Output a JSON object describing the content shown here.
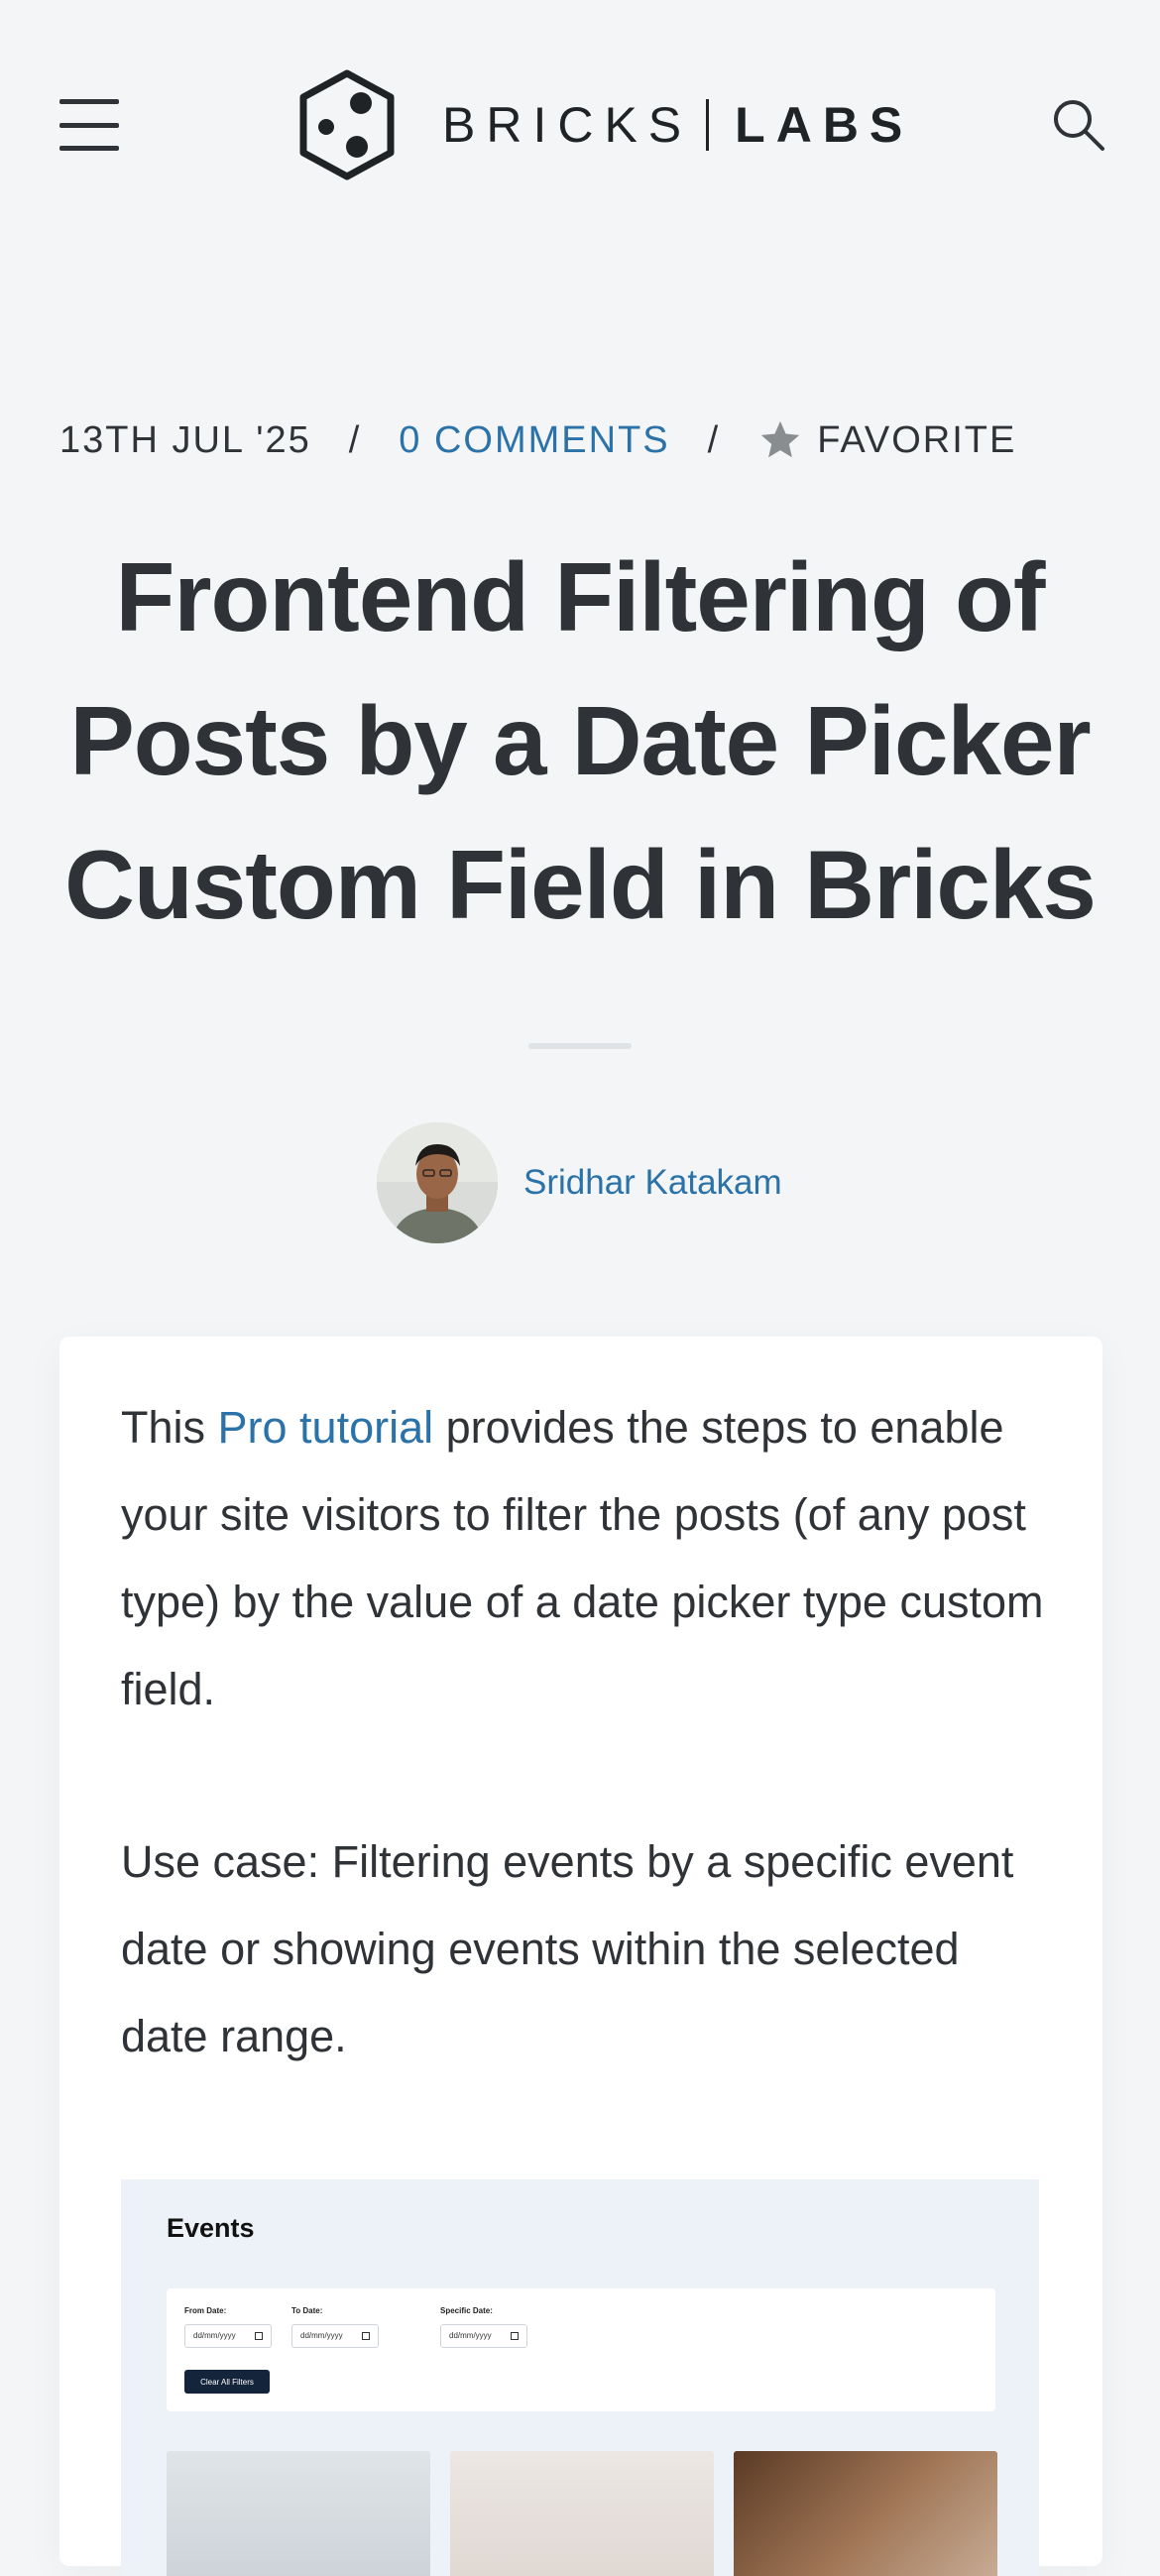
{
  "header": {
    "logo_brand": "BRICKS",
    "logo_product": "LABS",
    "menu_icon": "hamburger-menu-icon",
    "search_icon": "search-icon"
  },
  "meta": {
    "date": "13TH JUL '25",
    "separator": "/",
    "comments": "0 COMMENTS",
    "favorite": "FAVORITE"
  },
  "article": {
    "title": "Frontend Filtering of Posts by a Date Picker Custom Field in Bricks",
    "author": "Sridhar Katakam",
    "intro_before_link": "This ",
    "intro_link": "Pro tutorial",
    "intro_after_link": " provides the steps to enable your site visitors to filter the posts (of any post type) by the value of a date picker type custom field.",
    "use_case": "Use case: Filtering events by a specific event date or showing events within the selected date range."
  },
  "screenshot": {
    "title": "Events",
    "from_label": "From Date:",
    "to_label": "To Date:",
    "specific_label": "Specific Date:",
    "date_placeholder": "dd/mm/yyyy",
    "clear_button": "Clear All Filters"
  },
  "colors": {
    "link": "#2a72a8",
    "text": "#2f3337",
    "background": "#f3f5f7",
    "button_dark": "#14243a"
  }
}
